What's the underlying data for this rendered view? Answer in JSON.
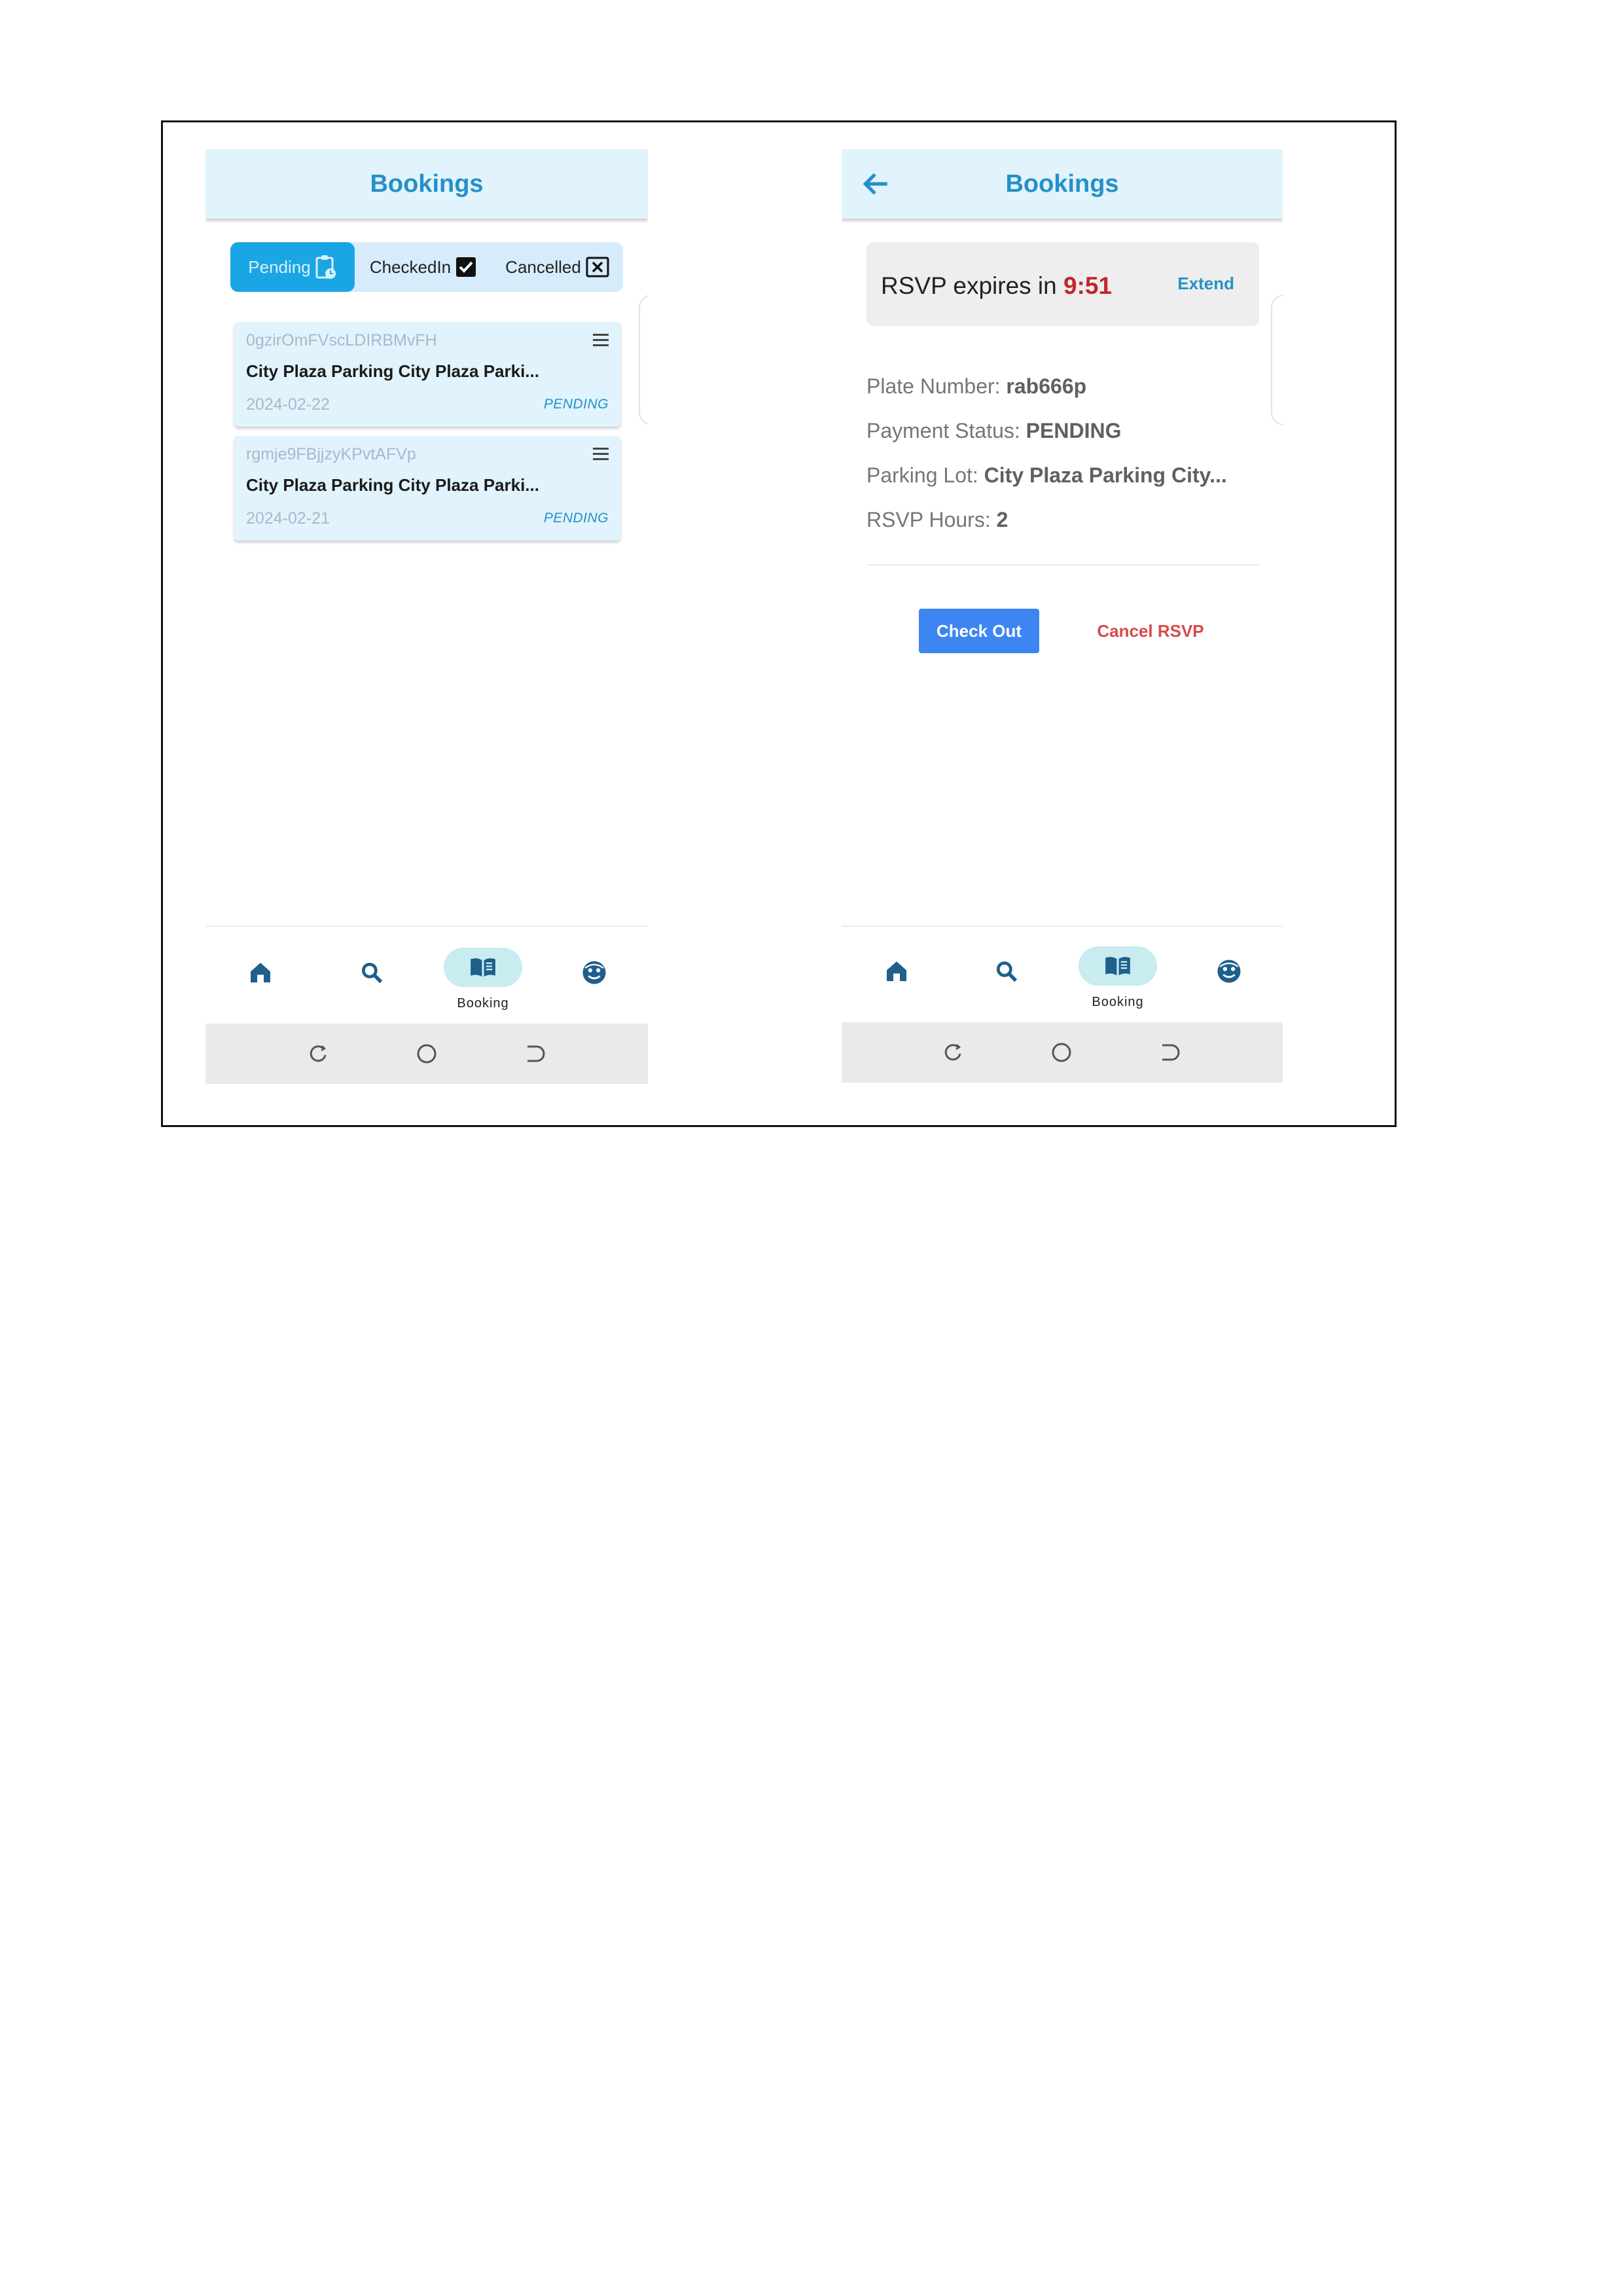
{
  "left_screen": {
    "title": "Bookings",
    "tabs": [
      {
        "label": "Pending",
        "active": true,
        "icon": "clipboard-clock-icon"
      },
      {
        "label": "CheckedIn",
        "active": false,
        "icon": "checkbox-checked-icon"
      },
      {
        "label": "Cancelled",
        "active": false,
        "icon": "checkbox-x-icon"
      }
    ],
    "bookings": [
      {
        "id": "0gzirOmFVscLDIRBMvFH",
        "name": "City Plaza Parking City Plaza Parki...",
        "date": "2024-02-22",
        "status": "PENDING"
      },
      {
        "id": "rgmje9FBjjzyKPvtAFVp",
        "name": "City Plaza Parking City Plaza Parki...",
        "date": "2024-02-21",
        "status": "PENDING"
      }
    ],
    "nav": {
      "booking_label": "Booking"
    }
  },
  "right_screen": {
    "title": "Bookings",
    "rsvp": {
      "prefix": "RSVP expires in ",
      "time": "9:51",
      "extend_label": "Extend"
    },
    "details": [
      {
        "label": "Plate Number: ",
        "value": "rab666p"
      },
      {
        "label": "Payment Status: ",
        "value": "PENDING"
      },
      {
        "label": "Parking Lot: ",
        "value": "City Plaza Parking City..."
      },
      {
        "label": "RSVP Hours: ",
        "value": "2"
      }
    ],
    "checkout_label": "Check Out",
    "cancel_label": "Cancel RSVP",
    "nav": {
      "booking_label": "Booking"
    }
  },
  "colors": {
    "appbar_bg": "#e1f3fc",
    "accent_blue": "#2590c9",
    "active_tab": "#1aa5e4",
    "checkout_button": "#3d86f2",
    "cancel_text": "#d84a4a",
    "timer_red": "#c0272d",
    "nav_icon": "#1f5f8b"
  }
}
